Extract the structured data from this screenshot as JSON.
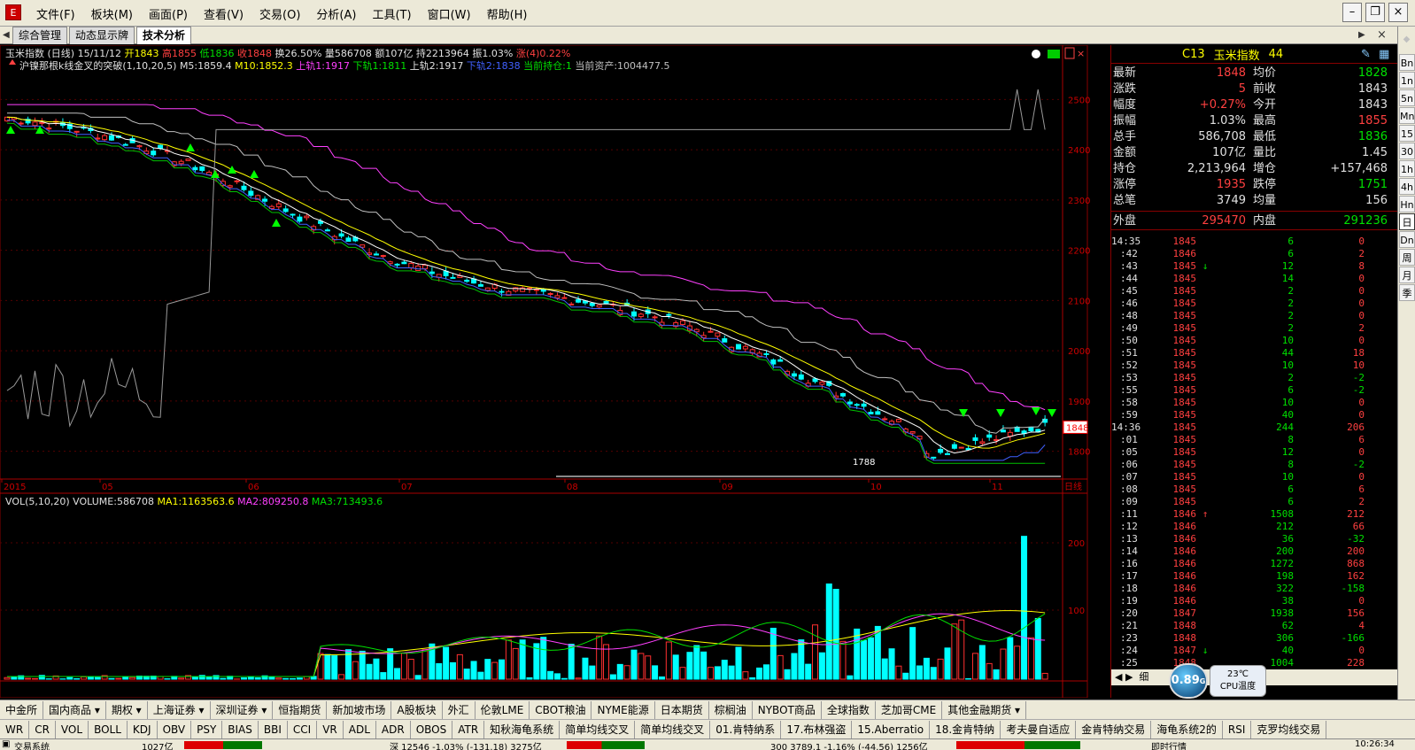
{
  "menubar": {
    "items": [
      "文件(F)",
      "板块(M)",
      "画面(P)",
      "查看(V)",
      "交易(O)",
      "分析(A)",
      "工具(T)",
      "窗口(W)",
      "帮助(H)"
    ]
  },
  "tabs": [
    "综合管理",
    "动态显示牌",
    "技术分析"
  ],
  "chart_header": {
    "line1": [
      {
        "t": "玉米指数 (日线) 15/11/12 ",
        "c": "#e0e0e0"
      },
      {
        "t": "开1843",
        "c": "#ffff00"
      },
      {
        "t": " 高1855",
        "c": "#ff4040"
      },
      {
        "t": " 低1836",
        "c": "#00e000"
      },
      {
        "t": " 收1848",
        "c": "#ff4040"
      },
      {
        "t": " 换26.50% 量586708 额107亿 持2213964 振1.03% ",
        "c": "#e0e0e0"
      },
      {
        "t": "涨(4)0.22%",
        "c": "#ff4040"
      }
    ],
    "line2": [
      {
        "t": "沪镍那根k线金叉的突破(1,10,20,5) ",
        "c": "#e0e0e0"
      },
      {
        "t": "M5:1859.4",
        "c": "#e0e0e0"
      },
      {
        "t": " M10:1852.3",
        "c": "#ffff00"
      },
      {
        "t": " 上轨1:1917",
        "c": "#ff40ff"
      },
      {
        "t": " 下轨1:1811",
        "c": "#00e000"
      },
      {
        "t": " 上轨2:1917",
        "c": "#e0e0e0"
      },
      {
        "t": " 下轨2:1838",
        "c": "#4060ff"
      },
      {
        "t": " 当前持仓:1",
        "c": "#00e000"
      },
      {
        "t": " 当前资产:1004477.5",
        "c": "#c0c0c0"
      }
    ]
  },
  "vol_header": [
    {
      "t": "VOL(5,10,20) VOLUME:586708",
      "c": "#e0e0e0"
    },
    {
      "t": " MA1:1163563.6",
      "c": "#ffff00"
    },
    {
      "t": " MA2:809250.8",
      "c": "#ff40ff"
    },
    {
      "t": " MA3:713493.6",
      "c": "#00e000"
    }
  ],
  "price_axis": {
    "ticks": [
      "2500",
      "2400",
      "2300",
      "2200",
      "2100",
      "2000",
      "1900",
      "1800"
    ],
    "current": "1848"
  },
  "vol_axis": {
    "ticks": [
      "200",
      "100"
    ]
  },
  "date_axis": {
    "labels": [
      "2015",
      "05",
      "06",
      "07",
      "08",
      "09",
      "10",
      "11",
      "日线"
    ]
  },
  "low_label": "1788",
  "quote": {
    "code": "C13",
    "name": "玉米指数",
    "num": "44",
    "rows": [
      {
        "l1": "最新",
        "v1": "1848",
        "c1": "red",
        "l2": "均价",
        "v2": "1828",
        "c2": "green"
      },
      {
        "l1": "涨跌",
        "v1": "5",
        "c1": "red",
        "l2": "前收",
        "v2": "1843",
        "c2": "white"
      },
      {
        "l1": "幅度",
        "v1": "+0.27%",
        "c1": "red",
        "l2": "今开",
        "v2": "1843",
        "c2": "white"
      },
      {
        "l1": "振幅",
        "v1": "1.03%",
        "c1": "white",
        "l2": "最高",
        "v2": "1855",
        "c2": "red"
      },
      {
        "l1": "总手",
        "v1": "586,708",
        "c1": "white",
        "l2": "最低",
        "v2": "1836",
        "c2": "green"
      },
      {
        "l1": "金额",
        "v1": "107亿",
        "c1": "white",
        "l2": "量比",
        "v2": "1.45",
        "c2": "white"
      },
      {
        "l1": "持仓",
        "v1": "2,213,964",
        "c1": "white",
        "l2": "增仓",
        "v2": "+157,468",
        "c2": "white"
      },
      {
        "l1": "涨停",
        "v1": "1935",
        "c1": "red",
        "l2": "跌停",
        "v2": "1751",
        "c2": "green"
      },
      {
        "l1": "总笔",
        "v1": "3749",
        "c1": "white",
        "l2": "均量",
        "v2": "156",
        "c2": "white"
      }
    ],
    "outer": {
      "l1": "外盘",
      "v1": "295470",
      "l2": "内盘",
      "v2": "291236"
    },
    "ticks": [
      [
        "14:35",
        "1845",
        "",
        "6",
        "0"
      ],
      [
        ":42",
        "1846",
        "",
        "6",
        "2"
      ],
      [
        ":43",
        "1845",
        "↓",
        "12",
        "8"
      ],
      [
        ":44",
        "1845",
        "",
        "14",
        "0"
      ],
      [
        ":45",
        "1845",
        "",
        "2",
        "0"
      ],
      [
        ":46",
        "1845",
        "",
        "2",
        "0"
      ],
      [
        ":48",
        "1845",
        "",
        "2",
        "0"
      ],
      [
        ":49",
        "1845",
        "",
        "2",
        "2"
      ],
      [
        ":50",
        "1845",
        "",
        "10",
        "0"
      ],
      [
        ":51",
        "1845",
        "",
        "44",
        "18"
      ],
      [
        ":52",
        "1845",
        "",
        "10",
        "10"
      ],
      [
        ":53",
        "1845",
        "",
        "2",
        "-2"
      ],
      [
        ":55",
        "1845",
        "",
        "6",
        "-2"
      ],
      [
        ":58",
        "1845",
        "",
        "10",
        "0"
      ],
      [
        ":59",
        "1845",
        "",
        "40",
        "0"
      ],
      [
        "14:36",
        "1845",
        "",
        "244",
        "206"
      ],
      [
        ":01",
        "1845",
        "",
        "8",
        "6"
      ],
      [
        ":05",
        "1845",
        "",
        "12",
        "0"
      ],
      [
        ":06",
        "1845",
        "",
        "8",
        "-2"
      ],
      [
        ":07",
        "1845",
        "",
        "10",
        "0"
      ],
      [
        ":08",
        "1845",
        "",
        "6",
        "6"
      ],
      [
        ":09",
        "1845",
        "",
        "6",
        "2"
      ],
      [
        ":11",
        "1846",
        "↑",
        "1508",
        "212"
      ],
      [
        ":12",
        "1846",
        "",
        "212",
        "66"
      ],
      [
        ":13",
        "1846",
        "",
        "36",
        "-32"
      ],
      [
        ":14",
        "1846",
        "",
        "200",
        "200"
      ],
      [
        ":16",
        "1846",
        "",
        "1272",
        "868"
      ],
      [
        ":17",
        "1846",
        "",
        "198",
        "162"
      ],
      [
        ":18",
        "1846",
        "",
        "322",
        "-158"
      ],
      [
        ":19",
        "1846",
        "",
        "38",
        "0"
      ],
      [
        ":20",
        "1847",
        "",
        "1938",
        "156"
      ],
      [
        ":21",
        "1848",
        "",
        "62",
        "4"
      ],
      [
        ":23",
        "1848",
        "",
        "306",
        "-166"
      ],
      [
        ":24",
        "1847",
        "↓",
        "40",
        "0"
      ],
      [
        ":25",
        "1848",
        "",
        "1004",
        "228"
      ]
    ]
  },
  "cpu": {
    "value": "0.89",
    "unit": "G",
    "temp": "23℃",
    "label": "CPU温度"
  },
  "side_strip": [
    "Bn",
    "1n",
    "5n",
    "Mn",
    "15",
    "30",
    "1h",
    "4h",
    "Hn",
    "日",
    "Dn",
    "周",
    "月",
    "季"
  ],
  "bottom_tabs1": [
    "中金所",
    "国内商品 ▾",
    "期权 ▾",
    "上海证券 ▾",
    "深圳证券 ▾",
    "恒指期货",
    "新加坡市场",
    "A股板块",
    "外汇",
    "伦敦LME",
    "CBOT粮油",
    "NYME能源",
    "日本期货",
    "棕榈油",
    "NYBOT商品",
    "全球指数",
    "芝加哥CME",
    "其他金融期货 ▾"
  ],
  "bottom_tabs2": [
    "WR",
    "CR",
    "VOL",
    "BOLL",
    "KDJ",
    "OBV",
    "PSY",
    "BIAS",
    "BBI",
    "CCI",
    "VR",
    "ADL",
    "ADR",
    "OBOS",
    "ATR",
    "知秋海龟系统",
    "简单均线交叉",
    "简单均线交叉",
    "01.肯特纳系",
    "17.布林强盗",
    "15.Aberratio",
    "18.金肯特纳",
    "考夫曼自适应",
    "金肯特纳交易",
    "海龟系统2的",
    "RSI",
    "克罗均线交易"
  ],
  "statusbar": {
    "left": "交易系统",
    "seg1": "1027亿",
    "seg2": "深 12546 -1.03% (-131.18) 3275亿",
    "seg3": "300 3789.1 -1.16% (-44.56) 1256亿",
    "seg4": "即时行情",
    "clock": "10:26:34"
  }
}
